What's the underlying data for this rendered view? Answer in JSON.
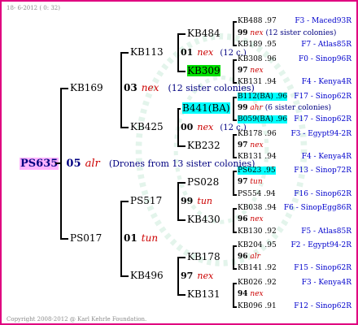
{
  "header": {
    "date": "18-  6-2012 (  0: 32)"
  },
  "footer": {
    "copyright": "Copyright 2008-2012 @ Karl Kehrle Foundation."
  },
  "root": {
    "id": "PS635",
    "num": "05",
    "label": "alr",
    "note": "(Drones from 13 sister colonies)"
  },
  "gen2": [
    {
      "id": "KB169",
      "num": "03",
      "label": "nex",
      "note": "(12 sister colonies)"
    },
    {
      "id": "PS017",
      "num": "01",
      "label": "tun",
      "note": ""
    }
  ],
  "gen3": [
    {
      "id": "KB113",
      "num": "01",
      "label": "nex",
      "note": "(12 c.)"
    },
    {
      "id": "KB425",
      "num": "00",
      "label": "nex",
      "note": "(12 c.)"
    },
    {
      "id": "PS517",
      "num": "99",
      "label": "tun",
      "note": ""
    },
    {
      "id": "KB496",
      "num": "97",
      "label": "nex",
      "note": ""
    }
  ],
  "gen4": [
    {
      "id": "KB484",
      "num": "99",
      "label": "nex",
      "note": "(12 sister colonies)"
    },
    {
      "id": "KB309",
      "num": "97",
      "label": "nex",
      "note": ""
    },
    {
      "id": "B441(BA)",
      "num": "99",
      "label": "ahr",
      "note": "(6 sister colonies)"
    },
    {
      "id": "KB232",
      "num": "97",
      "label": "nex",
      "note": ""
    },
    {
      "id": "PS028",
      "num": "97",
      "label": "tun",
      "note": ""
    },
    {
      "id": "KB430",
      "num": "96",
      "label": "nex",
      "note": ""
    },
    {
      "id": "KB178",
      "num": "96",
      "label": "alr",
      "note": ""
    },
    {
      "id": "KB131",
      "num": "94",
      "label": "nex",
      "note": ""
    }
  ],
  "gen5": [
    {
      "id": "KB488",
      "year": ".97",
      "origin": "F3 - Maced93R"
    },
    {
      "id": "KB189",
      "year": ".95",
      "origin": "F7 - Atlas85R"
    },
    {
      "id": "KB308",
      "year": ".96",
      "origin": "F0 - Sinop96R"
    },
    {
      "id": "KB131",
      "year": ".94",
      "origin": "F4 - Kenya4R"
    },
    {
      "id": "B112(BA)",
      "year": ".96",
      "origin": "F17 - Sinop62R"
    },
    {
      "id": "B059(BA)",
      "year": ".96",
      "origin": "F17 - Sinop62R"
    },
    {
      "id": "KB178",
      "year": ".96",
      "origin": "F3 - Egypt94-2R"
    },
    {
      "id": "KB131",
      "year": ".94",
      "origin": "F4 - Kenya4R"
    },
    {
      "id": "PS623",
      "year": ".95",
      "origin": "F13 - Sinop72R"
    },
    {
      "id": "PS554",
      "year": ".94",
      "origin": "F16 - Sinop62R"
    },
    {
      "id": "KB038",
      "year": ".94",
      "origin": "F6 - SinopEgg86R"
    },
    {
      "id": "KB130",
      "year": ".92",
      "origin": "F5 - Atlas85R"
    },
    {
      "id": "KB204",
      "year": ".95",
      "origin": "F2 - Egypt94-2R"
    },
    {
      "id": "KB141",
      "year": ".92",
      "origin": "F15 - Sinop62R"
    },
    {
      "id": "KB026",
      "year": ".92",
      "origin": "F3 - Kenya4R"
    },
    {
      "id": "KB096",
      "year": ".91",
      "origin": "F12 - Sinop62R"
    }
  ]
}
